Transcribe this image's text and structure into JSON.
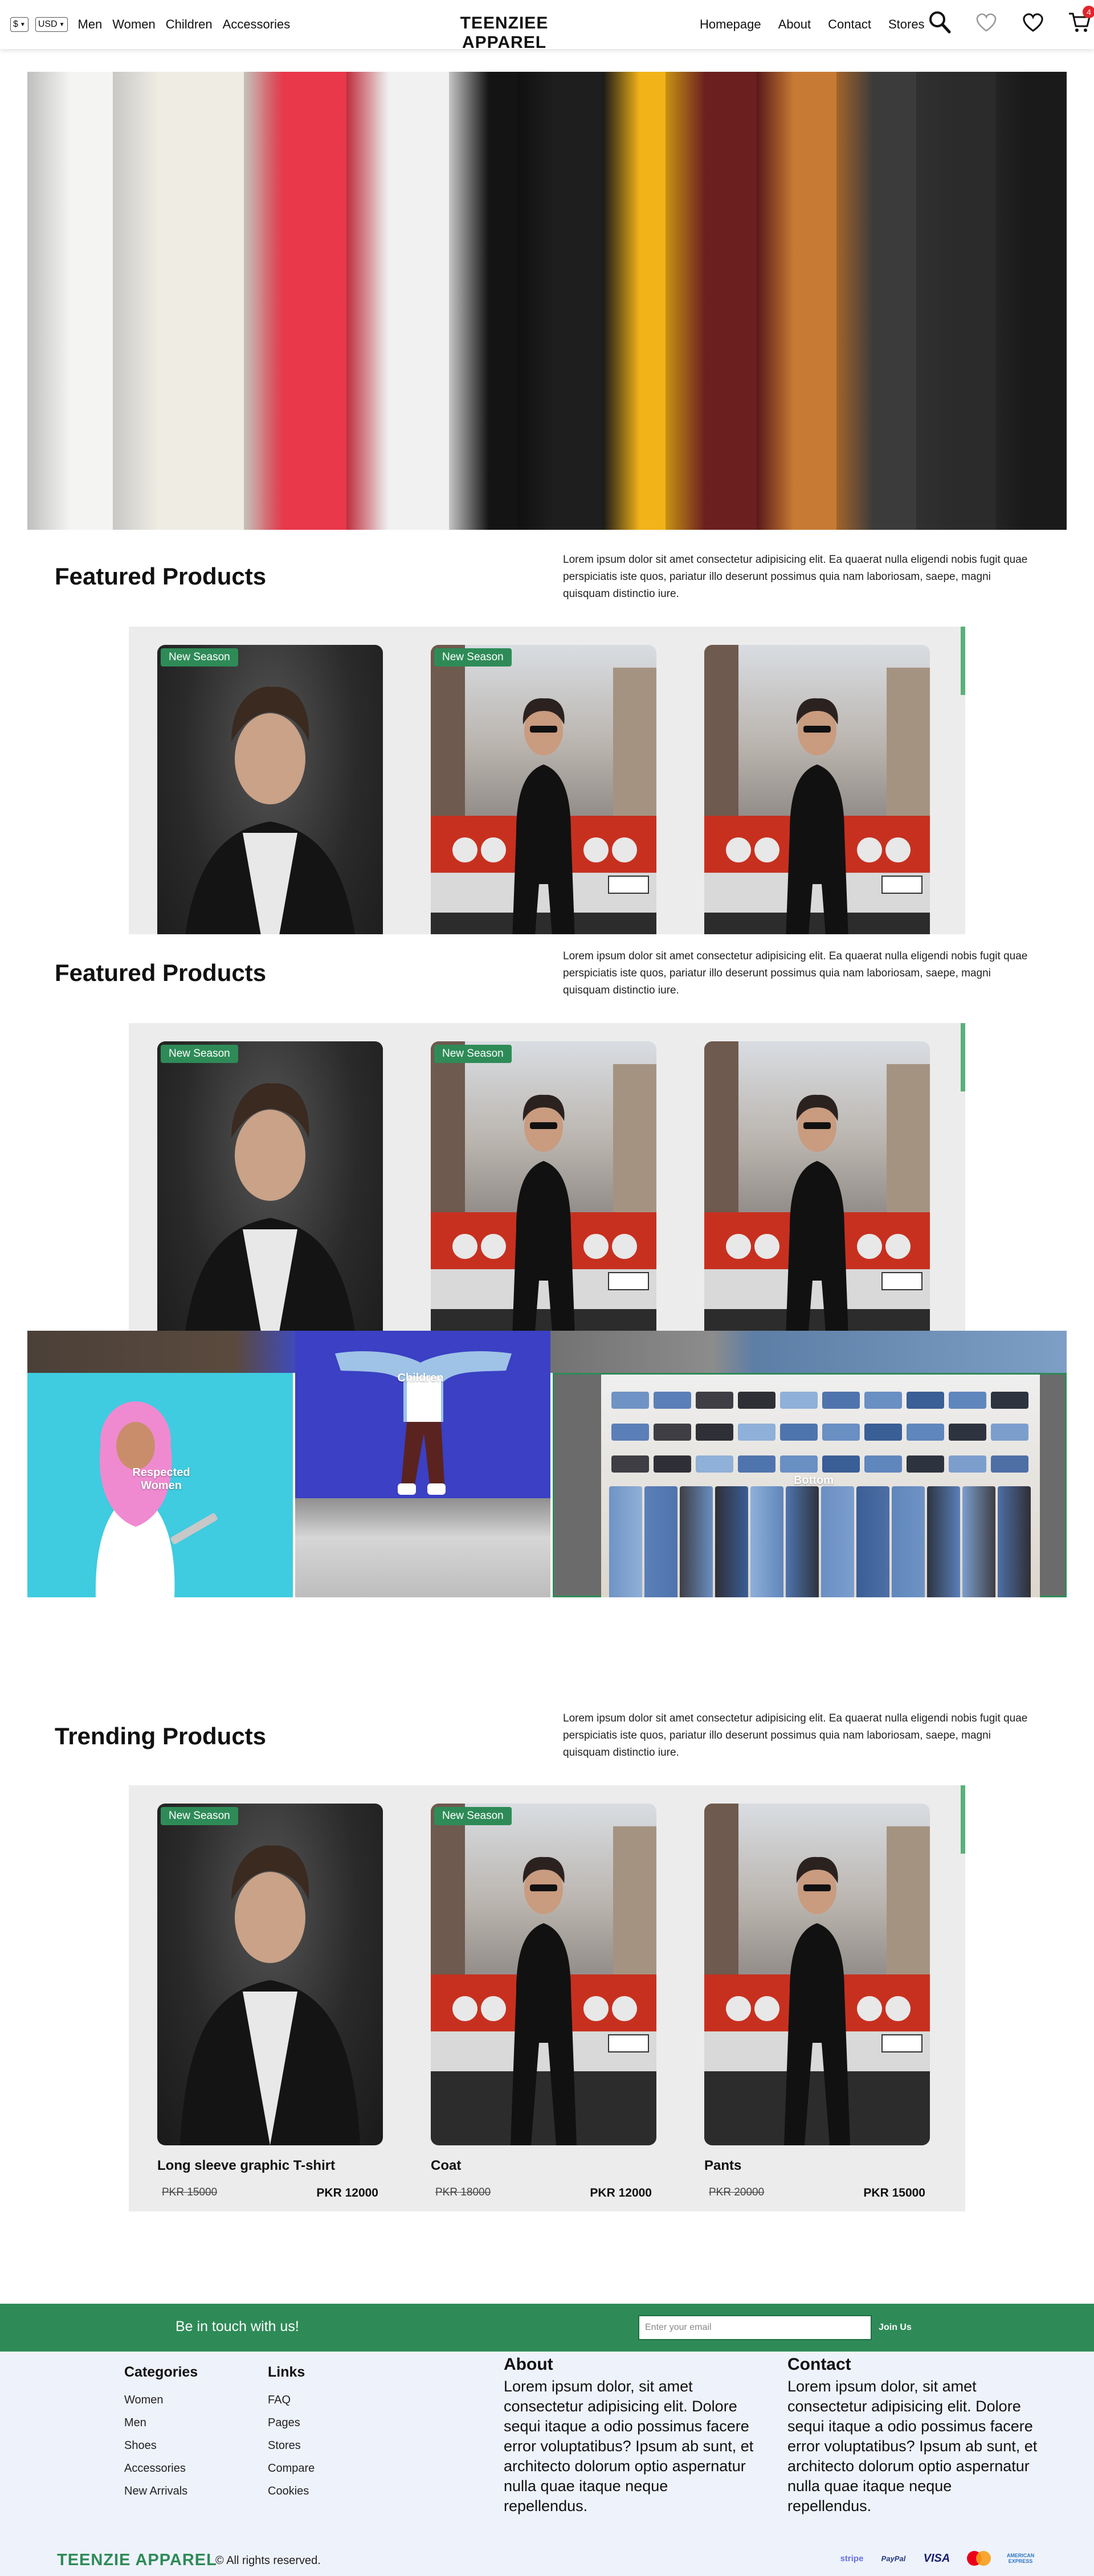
{
  "nav": {
    "language_value": "$",
    "currency_value": "USD",
    "left_links": [
      "Men",
      "Women",
      "Children",
      "Accessories"
    ],
    "brand": "TEENZIEE APPAREL",
    "right_links": [
      "Homepage",
      "About",
      "Contact",
      "Stores"
    ],
    "cart_count": "4",
    "icons": [
      "search-icon",
      "heart-outline-icon",
      "heart-icon",
      "cart-icon"
    ]
  },
  "hero": {
    "slide_controls": [
      "arrow-left-icon",
      "pause-icon",
      "dash-icon"
    ],
    "shirt_colors": [
      "#f4f4f2",
      "#efece4",
      "#e8384a",
      "#f1f1f1",
      "#141414",
      "#1e1e1e",
      "#f2b318",
      "#6b1f1f",
      "#c77a33",
      "#3b3b3b",
      "#2b2b2b",
      "#1a1a1a"
    ]
  },
  "sections": [
    {
      "title": "Featured Products",
      "description": "Lorem ipsum dolor sit amet consectetur adipisicing elit. Ea quaerat nulla eligendi nobis fugit quae perspiciatis iste quos, pariatur illo deserunt possimus quia nam laboriosam, saepe, magni quisquam distinctio iure."
    },
    {
      "title": "Featured Products",
      "description": "Lorem ipsum dolor sit amet consectetur adipisicing elit. Ea quaerat nulla eligendi nobis fugit quae perspiciatis iste quos, pariatur illo deserunt possimus quia nam laboriosam, saepe, magni quisquam distinctio iure."
    },
    {
      "title": "Trending Products",
      "description": "Lorem ipsum dolor sit amet consectetur adipisicing elit. Ea quaerat nulla eligendi nobis fugit quae perspiciatis iste quos, pariatur illo deserunt possimus quia nam laboriosam, saepe, magni quisquam distinctio iure."
    }
  ],
  "products": [
    {
      "badge": "New Season",
      "name": "Long sleeve graphic T-shirt",
      "old_price": "PKR 15000",
      "new_price": "PKR 12000"
    },
    {
      "badge": "New Season",
      "name": "Coat",
      "old_price": "PKR 18000",
      "new_price": "PKR 12000"
    },
    {
      "badge": "",
      "name": "Pants",
      "old_price": "PKR 20000",
      "new_price": "PKR 15000"
    }
  ],
  "categories": {
    "women": "Respected Women",
    "children": "Children",
    "bottom": "Bottom"
  },
  "newsletter": {
    "text": "Be in touch with us!",
    "placeholder": "Enter your email",
    "button": "Join Us"
  },
  "footer": {
    "categories_heading": "Categories",
    "categories": [
      "Women",
      "Men",
      "Shoes",
      "Accessories",
      "New Arrivals"
    ],
    "links_heading": "Links",
    "links": [
      "FAQ",
      "Pages",
      "Stores",
      "Compare",
      "Cookies"
    ],
    "about_heading": "About",
    "about_text": "Lorem ipsum dolor, sit amet consectetur adipisicing elit. Dolore sequi itaque a odio possimus facere error voluptatibus? Ipsum ab sunt, et architecto dolorum optio aspernatur nulla quae itaque neque repellendus.",
    "contact_heading": "Contact",
    "contact_text": "Lorem ipsum dolor, sit amet consectetur adipisicing elit. Dolore sequi itaque a odio possimus facere error voluptatibus? Ipsum ab sunt, et architecto dolorum optio aspernatur nulla quae itaque neque repellendus.",
    "brand": "TEENZIE APPAREL",
    "copyright": "© All rights reserved.",
    "payments": [
      "stripe",
      "PayPal",
      "VISA",
      "mastercard",
      "AMERICAN EXPRESS"
    ]
  },
  "colors": {
    "brand_green": "#2e8b57",
    "badge_red": "#e3242b",
    "footer_bg": "#eef2fb",
    "strip_bg": "#ececec"
  }
}
